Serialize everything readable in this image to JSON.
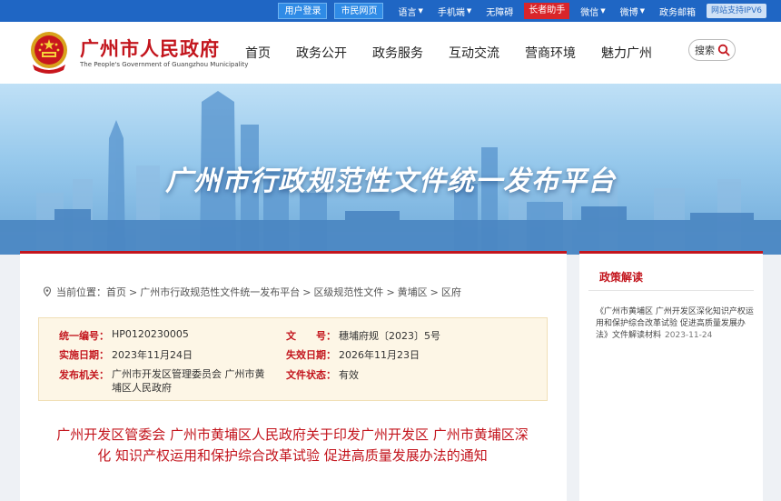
{
  "topbar": {
    "login": "用户登录",
    "citizen": "市民网页",
    "language": "语言",
    "mobile": "手机端",
    "accessible": "无障碍",
    "elder": "长者助手",
    "wechat": "微信",
    "weibo": "微博",
    "mailbox": "政务邮箱",
    "ipv6": "网站支持IPV6"
  },
  "header": {
    "site_name": "广州市人民政府",
    "site_name_en": "The People's Government of Guangzhou Municipality",
    "nav": [
      "首页",
      "政务公开",
      "政务服务",
      "互动交流",
      "营商环境",
      "魅力广州"
    ],
    "search_label": "搜索"
  },
  "banner": {
    "title": "广州市行政规范性文件统一发布平台"
  },
  "breadcrumb": {
    "prefix": "当前位置：",
    "items": [
      "首页",
      "广州市行政规范性文件统一发布平台",
      "区级规范性文件",
      "黄埔区",
      "区府"
    ]
  },
  "meta": {
    "unified_no_label": "统一编号：",
    "unified_no": "HP0120230005",
    "doc_no_label": "文　　号：",
    "doc_no": "穗埔府规〔2023〕5号",
    "impl_date_label": "实施日期：",
    "impl_date": "2023年11月24日",
    "expire_date_label": "失效日期：",
    "expire_date": "2026年11月23日",
    "issuer_label": "发布机关：",
    "issuer": "广州市开发区管理委员会 广州市黄埔区人民政府",
    "status_label": "文件状态：",
    "status": "有效"
  },
  "document": {
    "title": "广州开发区管委会 广州市黄埔区人民政府关于印发广州开发区 广州市黄埔区深化 知识产权运用和保护综合改革试验 促进高质量发展办法的通知"
  },
  "sidebar": {
    "title": "政策解读",
    "items": [
      {
        "text": "《广州市黄埔区 广州开发区深化知识产权运用和保护综合改革试验 促进高质量发展办法》文件解读材料",
        "date": "2023-11-24"
      }
    ]
  },
  "colors": {
    "brand_red": "#c3151d",
    "topbar_blue": "#1f66c4",
    "meta_bg": "#fdf6e6"
  }
}
